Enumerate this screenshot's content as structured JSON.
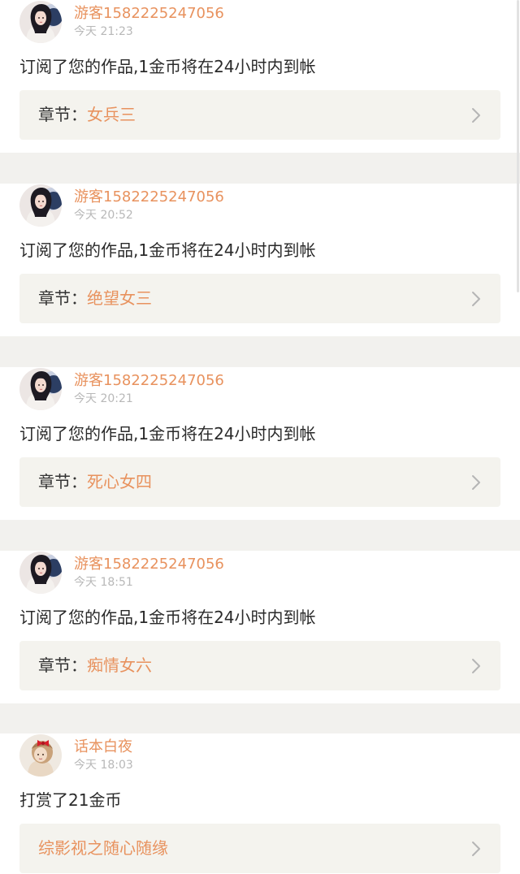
{
  "colors": {
    "accent": "#e8925e",
    "page_background": "#f2f1ee",
    "card_background": "#ffffff",
    "chapter_background": "#f4f3ee",
    "body_text": "#2a2a2a",
    "muted_text": "#b8b8b8"
  },
  "notifications": [
    {
      "avatar_icon": "woman-portrait-avatar",
      "username": "游客1582225247056",
      "time": "今天 21:23",
      "message": "订阅了您的作品,1金币将在24小时内到帐",
      "chapter_prefix": "章节：",
      "chapter_name": "女兵三",
      "chevron_icon": "chevron-right-icon"
    },
    {
      "avatar_icon": "woman-portrait-avatar",
      "username": "游客1582225247056",
      "time": "今天 20:52",
      "message": "订阅了您的作品,1金币将在24小时内到帐",
      "chapter_prefix": "章节：",
      "chapter_name": "绝望女三",
      "chevron_icon": "chevron-right-icon"
    },
    {
      "avatar_icon": "woman-portrait-avatar",
      "username": "游客1582225247056",
      "time": "今天 20:21",
      "message": "订阅了您的作品,1金币将在24小时内到帐",
      "chapter_prefix": "章节：",
      "chapter_name": "死心女四",
      "chevron_icon": "chevron-right-icon"
    },
    {
      "avatar_icon": "woman-portrait-avatar",
      "username": "游客1582225247056",
      "time": "今天 18:51",
      "message": "订阅了您的作品,1金币将在24小时内到帐",
      "chapter_prefix": "章节：",
      "chapter_name": "痴情女六",
      "chevron_icon": "chevron-right-icon"
    },
    {
      "avatar_icon": "girl-with-red-bow-avatar",
      "username": "话本白夜",
      "time": "今天 18:03",
      "message": "打赏了21金币",
      "chapter_prefix": "",
      "chapter_name": "综影视之随心随缘",
      "chevron_icon": "chevron-right-icon"
    }
  ]
}
